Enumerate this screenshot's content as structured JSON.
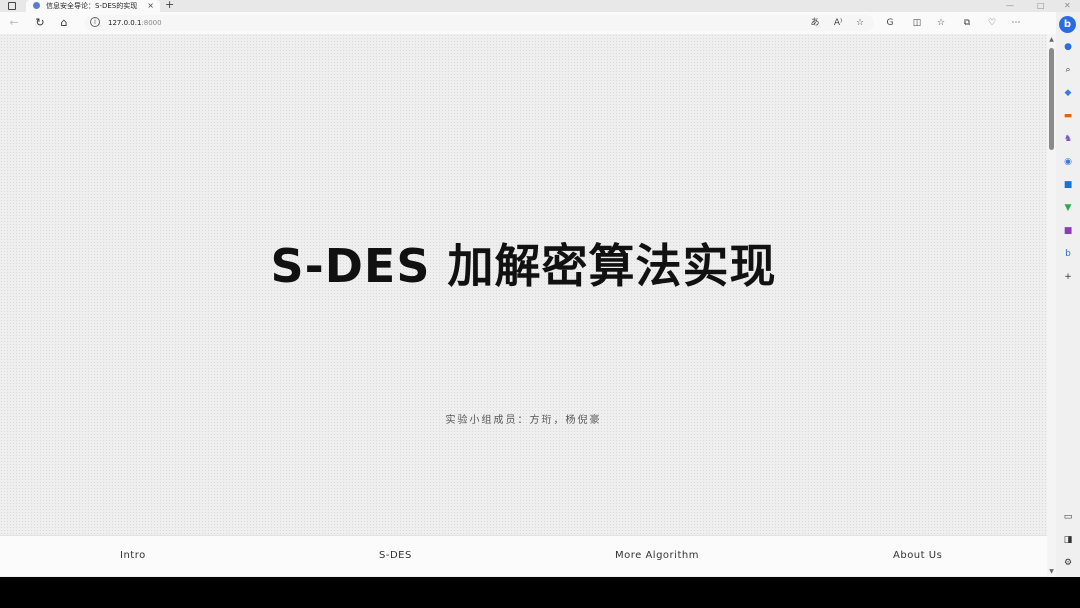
{
  "browser": {
    "tab_title": "信息安全导论：S-DES的实现",
    "tab_close": "×",
    "new_tab": "+",
    "window_controls": {
      "minimize": "—",
      "maximize": "□",
      "close": "✕"
    },
    "url_host": "127.0.0.1",
    "url_port": ":8000",
    "info_glyph": "i",
    "nav": {
      "back": "←",
      "reload": "↻",
      "home": "⌂"
    },
    "toolbar": {
      "translate": "あ",
      "read_aloud": "A⁾",
      "favorite": "☆",
      "refresh_ext": "G",
      "split": "◫",
      "favorites_list": "☆",
      "collections": "⧉",
      "performance": "♡",
      "more": "⋯"
    }
  },
  "page": {
    "title": "S-DES 加解密算法实现",
    "members": "实验小组成员：方珩，杨倪豪",
    "nav": [
      "Intro",
      "S-DES",
      "More Algorithm",
      "About Us"
    ]
  },
  "sidebar": {
    "bing": "b",
    "icons": [
      "search-icon",
      "tag-icon",
      "toolbox-icon",
      "games-icon",
      "microsoft365-icon",
      "outlook-icon",
      "drop-icon",
      "onenote-icon",
      "bing-small-icon",
      "add-icon",
      "screen-icon",
      "sidebar-toggle-icon",
      "settings-icon"
    ],
    "add": "+",
    "settings": "⚙"
  },
  "colors": {
    "bing": "#2b6de0",
    "title": "#111111",
    "page_bg": "#efefef"
  }
}
